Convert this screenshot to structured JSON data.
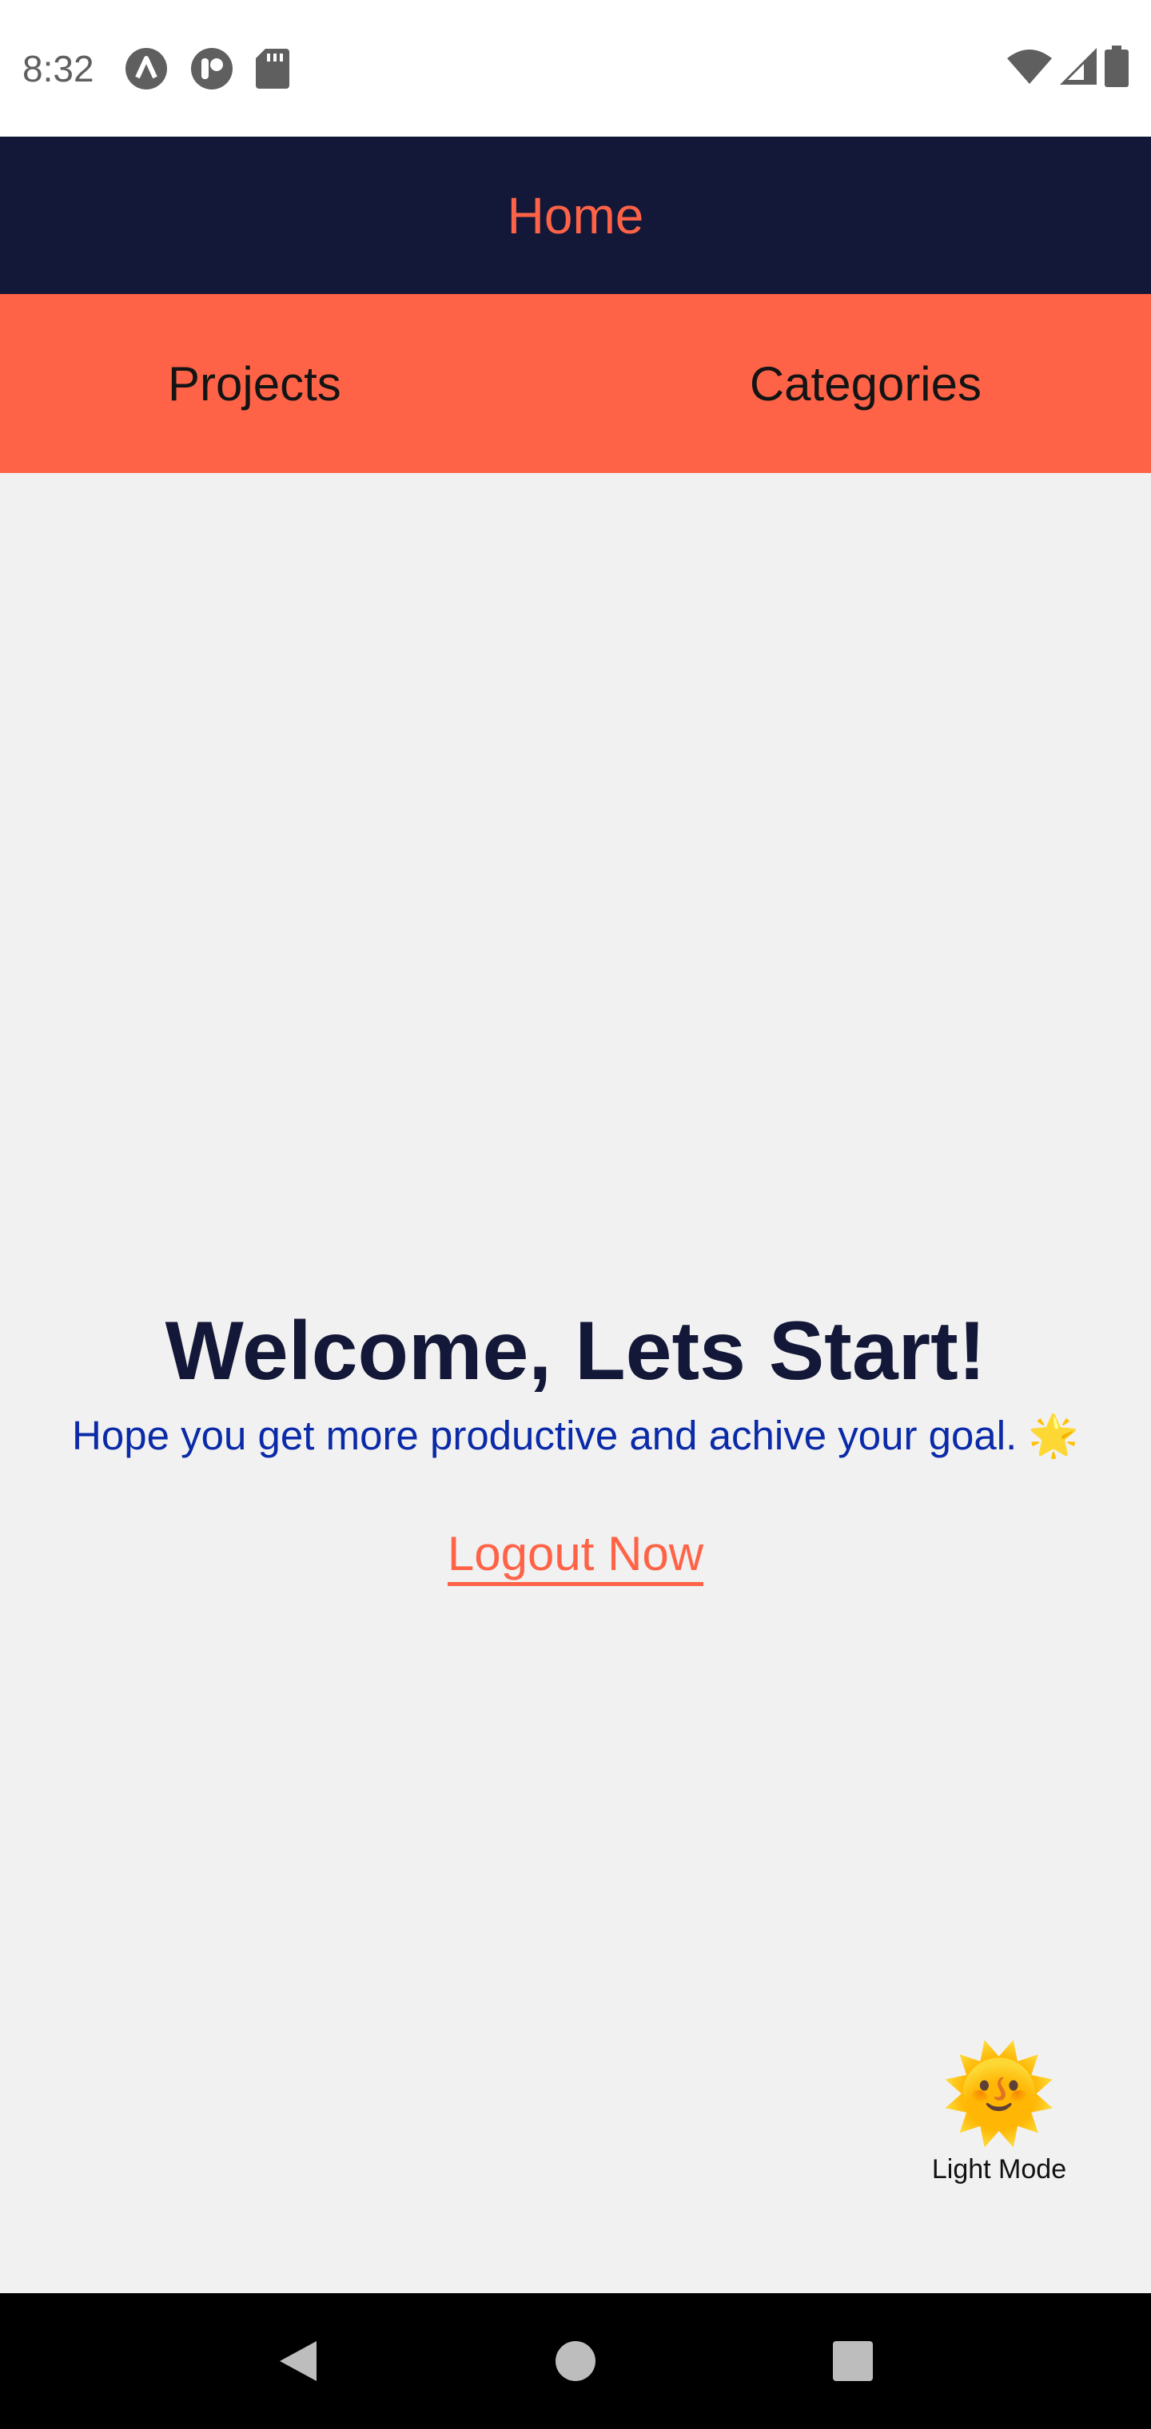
{
  "status_bar": {
    "time": "8:32",
    "icons": [
      "a-circle-icon",
      "p-circle-icon",
      "sd-card-icon"
    ],
    "right_icons": [
      "wifi-icon",
      "signal-icon",
      "battery-icon"
    ]
  },
  "header": {
    "title": "Home"
  },
  "tabs": [
    {
      "label": "Projects"
    },
    {
      "label": "Categories"
    }
  ],
  "main": {
    "title": "Welcome, Lets Start!",
    "subtitle": "Hope you get more productive and achive your goal. 🌟",
    "logout_label": "Logout Now"
  },
  "mode_toggle": {
    "emoji": "🌞",
    "label": "Light Mode"
  },
  "nav_bar": {
    "buttons": [
      "back-icon",
      "home-icon",
      "recents-icon"
    ]
  },
  "colors": {
    "header_bg": "#141838",
    "accent": "#ff6347",
    "subtitle": "#0a2aa8",
    "background": "#f1f1f1"
  }
}
